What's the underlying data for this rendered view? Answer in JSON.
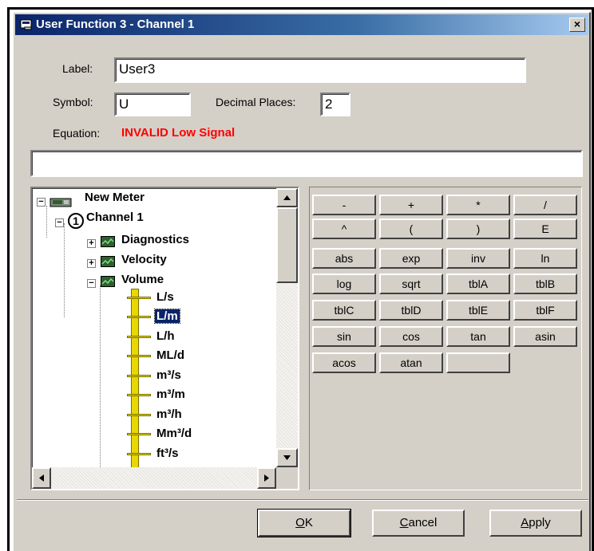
{
  "window": {
    "title": "User Function 3 - Channel 1",
    "close_label": "×"
  },
  "form": {
    "label_caption": "Label:",
    "label_value": "User3",
    "symbol_caption": "Symbol:",
    "symbol_value": "U",
    "decimal_caption": "Decimal Places:",
    "decimal_value": "2",
    "equation_caption": "Equation:",
    "equation_status": "INVALID Low Signal",
    "equation_value": ""
  },
  "tree": {
    "root": "New Meter",
    "channel": "Channel 1",
    "groups": [
      "Diagnostics",
      "Velocity",
      "Volume"
    ],
    "units": [
      "L/s",
      "L/m",
      "L/h",
      "ML/d",
      "m³/s",
      "m³/m",
      "m³/h",
      "Mm³/d",
      "ft³/s"
    ],
    "selected_unit": "L/m"
  },
  "keypad": [
    [
      "-",
      "+",
      "*",
      "/"
    ],
    [
      "^",
      "(",
      ")",
      "E"
    ],
    [
      "abs",
      "exp",
      "inv",
      "ln"
    ],
    [
      "log",
      "sqrt",
      "tblA",
      "tblB"
    ],
    [
      "tblC",
      "tblD",
      "tblE",
      "tblF"
    ],
    [
      "sin",
      "cos",
      "tan",
      "asin"
    ],
    [
      "acos",
      "atan",
      ""
    ]
  ],
  "buttons": {
    "ok": {
      "accel": "O",
      "rest": "K"
    },
    "cancel": {
      "accel": "C",
      "rest": "ancel"
    },
    "apply": {
      "accel": "A",
      "rest": "pply"
    }
  },
  "colors": {
    "title_start": "#0a246a",
    "title_end": "#a6caf0",
    "status_red": "#ff0000",
    "selection": "#0a246a"
  }
}
